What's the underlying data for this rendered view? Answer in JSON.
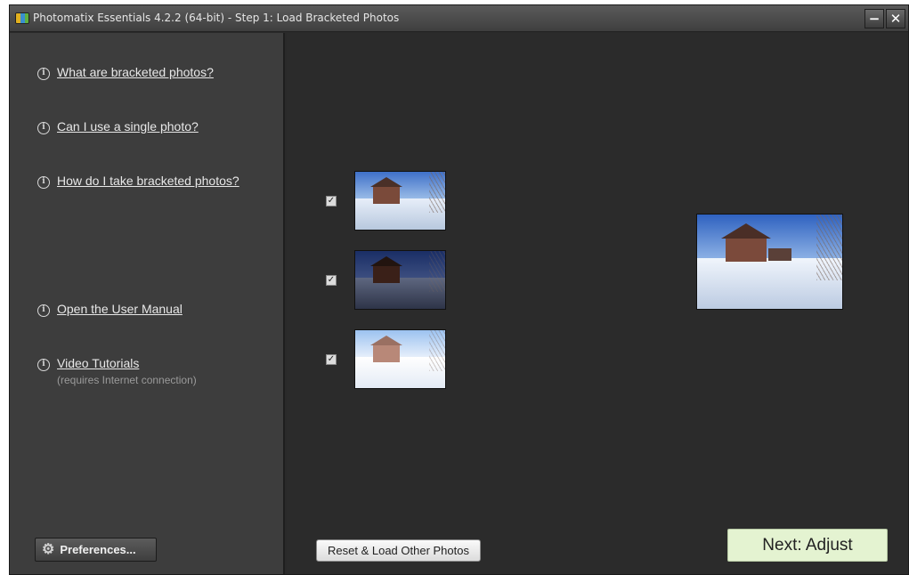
{
  "window": {
    "title": "Photomatix Essentials  4.2.2 (64-bit) - Step 1: Load Bracketed Photos",
    "minimize_label": "−",
    "close_label": "✕"
  },
  "sidebar": {
    "help_items": [
      {
        "label": "What are bracketed photos?",
        "icon": "info-icon"
      },
      {
        "label": "Can I use a single photo?",
        "icon": "info-icon"
      },
      {
        "label": "How do I take bracketed photos?",
        "icon": "info-icon"
      },
      {
        "label": "Open the User Manual",
        "icon": "info-icon"
      },
      {
        "label": "Video Tutorials",
        "sublabel": "(requires Internet connection)",
        "icon": "info-icon"
      }
    ],
    "preferences_label": "Preferences...",
    "preferences_icon": "gear-icon"
  },
  "main": {
    "bracketed_photos": [
      {
        "checked": true,
        "exposure": "normal"
      },
      {
        "checked": true,
        "exposure": "dark"
      },
      {
        "checked": true,
        "exposure": "bright"
      }
    ],
    "preview_icon": "photo-preview",
    "reset_label": "Reset & Load Other Photos",
    "next_label": "Next: Adjust"
  },
  "colors": {
    "sidebar_bg": "#3d3d3d",
    "main_bg": "#2b2b2b",
    "next_button_bg": "#e4f3d1"
  }
}
